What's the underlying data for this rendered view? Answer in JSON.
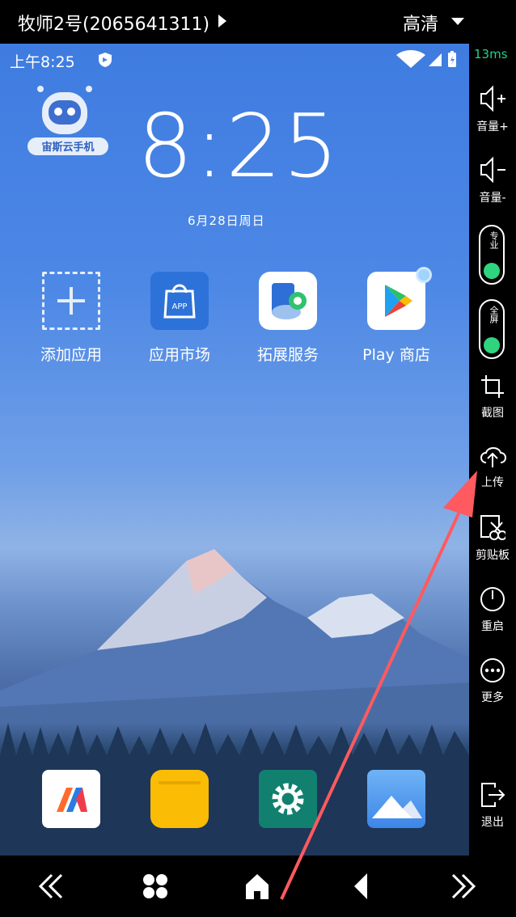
{
  "topbar": {
    "device_name": "牧师2号(2065641311)",
    "quality": "高清"
  },
  "statusbar": {
    "time": "上午8:25"
  },
  "home": {
    "logo_text": "宙斯云手机",
    "clock": "8:25",
    "date": "6月28日周日",
    "apps": [
      {
        "label": "添加应用",
        "icon": "add-app-icon"
      },
      {
        "label": "应用市场",
        "icon": "app-store-icon",
        "badge": "APP"
      },
      {
        "label": "拓展服务",
        "icon": "extension-service-icon"
      },
      {
        "label": "Play 商店",
        "icon": "play-store-icon"
      }
    ],
    "dock": [
      "video-app-icon",
      "files-icon",
      "settings-icon",
      "gallery-icon"
    ]
  },
  "sidebar": {
    "latency": "13ms",
    "volume_up": "音量+",
    "volume_down": "音量-",
    "toggle1": "专业",
    "toggle2": "全屏",
    "screenshot": "截图",
    "upload": "上传",
    "clipboard": "剪贴板",
    "reboot": "重启",
    "more": "更多",
    "exit": "退出"
  },
  "colors": {
    "latency": "#22d28a",
    "toggle_on": "#2fd47e",
    "annotation_arrow": "#ff5a5f"
  }
}
